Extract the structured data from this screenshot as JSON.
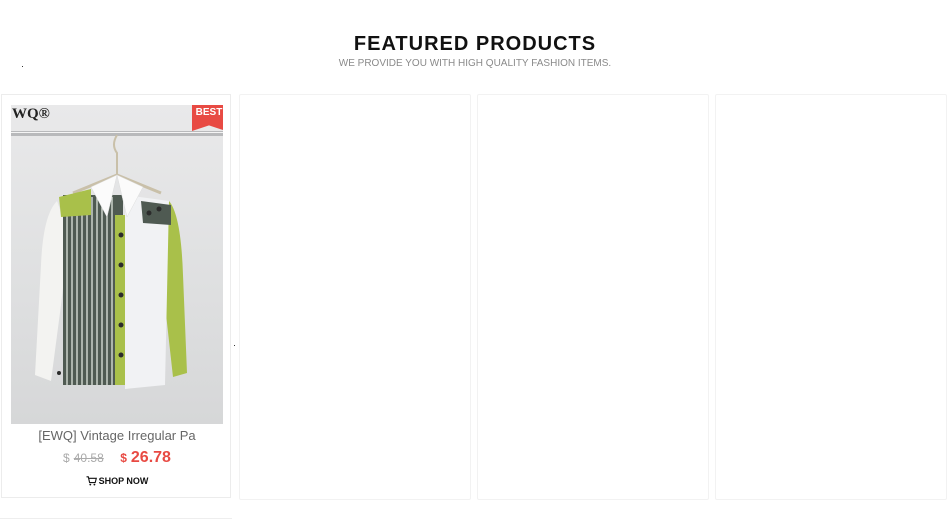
{
  "section": {
    "title": "FEATURED PRODUCTS",
    "subtitle": "WE PROVIDE YOU WITH HIGH QUALITY FASHION ITEMS."
  },
  "products": [
    {
      "brand_mark": "WQ®",
      "badge": "BEST",
      "name": "[EWQ] Vintage Irregular Pa",
      "currency": "$",
      "old_price": "40.58",
      "new_price": "26.78",
      "action_label": "SHOP NOW",
      "action_icon": "cart-icon",
      "image": "product-shirt-image"
    }
  ],
  "colors": {
    "accent": "#e84a43",
    "shirt_green": "#a9c04a",
    "card_border": "#ececec"
  }
}
